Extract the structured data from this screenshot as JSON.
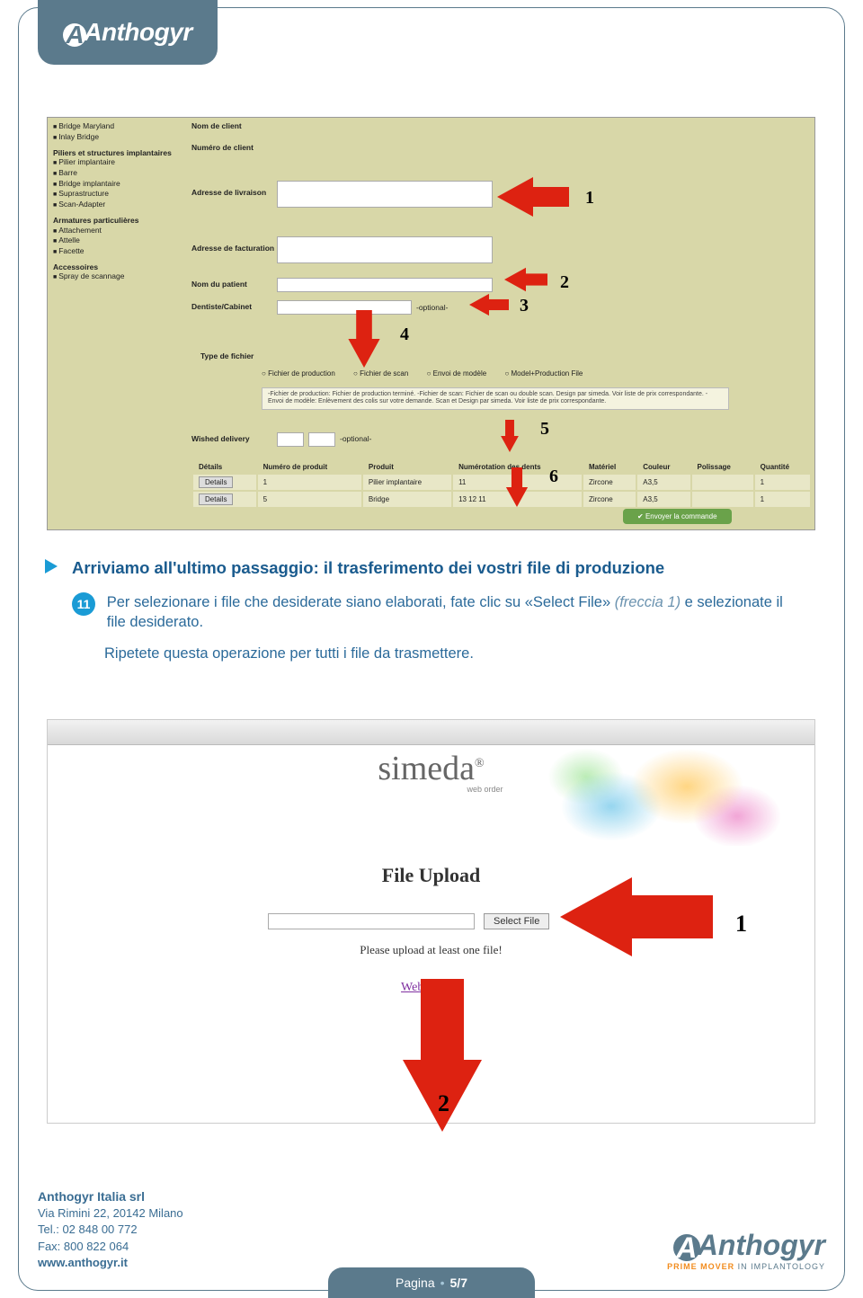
{
  "brand": "Anthogyr",
  "heading": "Arriviamo all'ultimo passaggio: il trasferimento dei vostri file di produzione",
  "step_number": "11",
  "step_text_1": "Per selezionare i file che desiderate siano elaborati, fate clic su «Select File» ",
  "step_text_freccia": "(freccia 1)",
  "step_text_2": " e selezionate il file desiderato.",
  "repeat_text": "Ripetete questa operazione per tutti i file da trasmettere.",
  "shot1": {
    "sidebar": {
      "item_bridge_maryland": "Bridge Maryland",
      "item_inlay": "Inlay Bridge",
      "grp_piliers": "Piliers et structures implantaires",
      "item_pilier": "Pilier implantaire",
      "item_barre": "Barre",
      "item_bridge_imp": "Bridge implantaire",
      "item_supra": "Suprastructure",
      "item_scan": "Scan-Adapter",
      "grp_armatures": "Armatures particulières",
      "item_attach": "Attachement",
      "item_attelle": "Attelle",
      "item_facette": "Facette",
      "grp_accessoires": "Accessoires",
      "item_spray": "Spray de scannage"
    },
    "labels": {
      "nom_client": "Nom de client",
      "numero_client": "Numéro de client",
      "adresse_livraison": "Adresse de livraison",
      "adresse_facturation": "Adresse de facturation",
      "nom_patient": "Nom du patient",
      "dentiste": "Dentiste/Cabinet",
      "optional": "-optional-",
      "type_fichier": "Type de fichier",
      "wished_delivery": "Wished delivery"
    },
    "radios": {
      "r1": "Fichier de production",
      "r2": "Fichier de scan",
      "r3": "Envoi de modèle",
      "r4": "Model+Production File"
    },
    "note": "-Fichier de production: Fichier de production terminé.\n-Fichier de scan: Fichier de scan ou double scan. Design par simeda. Voir liste de prix correspondante.\n-Envoi de modèle: Enlèvement des colis sur votre demande. Scan et Design par simeda. Voir liste de prix correspondante.",
    "table": {
      "h_details": "Détails",
      "h_numero": "Numéro de produit",
      "h_produit": "Produit",
      "h_numer": "Numérotation des dents",
      "h_materiel": "Matériel",
      "h_couleur": "Couleur",
      "h_polissage": "Polissage",
      "h_quantite": "Quantité",
      "r1_num": "1",
      "r1_prod": "Pilier implantaire",
      "r1_dents": "11",
      "r1_mat": "Zircone",
      "r1_coul": "A3,5",
      "r1_q": "1",
      "r2_num": "5",
      "r2_prod": "Bridge",
      "r2_dents": "13 12 11",
      "r2_mat": "Zircone",
      "r2_coul": "A3,5",
      "r2_q": "1",
      "details_btn": "Details"
    },
    "submit": "Envoyer la commande",
    "nums": {
      "n1": "1",
      "n2": "2",
      "n3": "3",
      "n4": "4",
      "n5": "5",
      "n6": "6"
    }
  },
  "shot2": {
    "brand": "simeda",
    "brand_sub": "web order",
    "title": "File Upload",
    "select_btn": "Select File",
    "please": "Please upload at least one file!",
    "web_orders": "Web Orders",
    "nums": {
      "n1": "1",
      "n2": "2"
    }
  },
  "footer": {
    "company": "Anthogyr Italia srl",
    "addr": "Via Rimini 22, 20142 Milano",
    "tel": "Tel.: 02 848 00 772",
    "fax": "Fax: 800 822 064",
    "url": "www.anthogyr.it",
    "page_label": "Pagina",
    "page_num": "5/7",
    "tagline_pm": "PRIME MOVER",
    "tagline_rest": " IN IMPLANTOLOGY"
  }
}
